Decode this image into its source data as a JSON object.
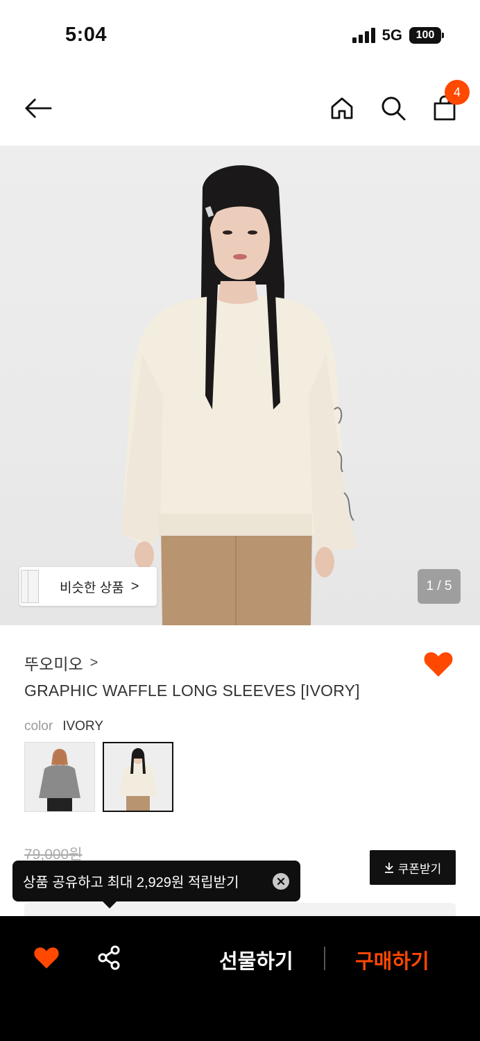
{
  "status_bar": {
    "time": "5:04",
    "network": "5G",
    "battery": "100"
  },
  "nav": {
    "back_icon": "arrow-left-icon",
    "home_icon": "home-icon",
    "search_icon": "search-icon",
    "cart_icon": "shopping-bag-icon",
    "cart_count": "4"
  },
  "hero": {
    "similar_label": "비슷한 상품",
    "similar_chevron": ">",
    "page_indicator": "1 / 5"
  },
  "product": {
    "brand": "뚜오미오",
    "brand_chevron": ">",
    "name": "GRAPHIC WAFFLE LONG SLEEVES [IVORY]",
    "color_label": "color",
    "color_value": "IVORY",
    "original_price": "79,000원",
    "coupon_label": "쿠폰받기"
  },
  "toast": {
    "message": "상품 공유하고 최대 2,929원 적립받기"
  },
  "bottom_bar": {
    "gift_label": "선물하기",
    "buy_label": "구매하기"
  },
  "colors": {
    "accent": "#ff4800",
    "dark": "#111111"
  }
}
